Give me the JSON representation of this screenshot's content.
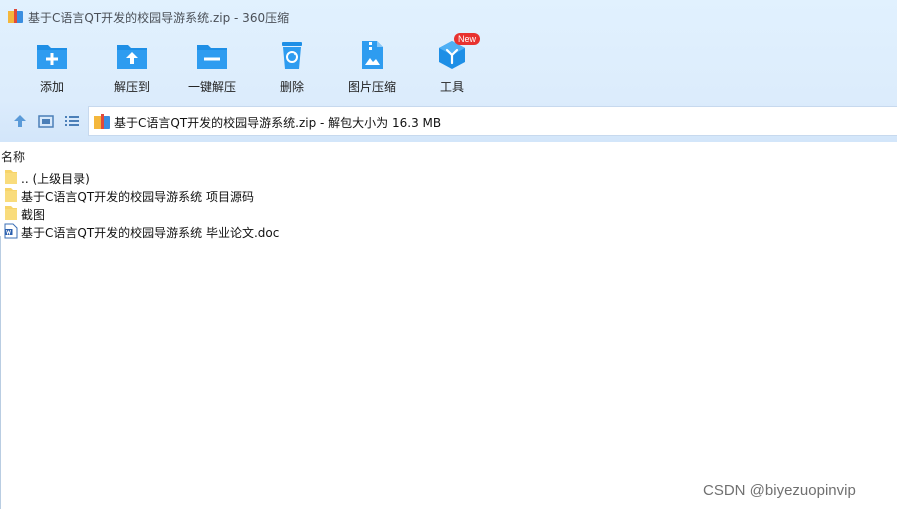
{
  "window": {
    "title": "基于C语言QT开发的校园导游系统.zip - 360压缩",
    "icon": "zip-archive-icon"
  },
  "toolbar": {
    "items": [
      {
        "label": "添加",
        "icon": "add-icon"
      },
      {
        "label": "解压到",
        "icon": "extract-to-icon"
      },
      {
        "label": "一键解压",
        "icon": "one-click-extract-icon"
      },
      {
        "label": "删除",
        "icon": "delete-icon"
      },
      {
        "label": "图片压缩",
        "icon": "image-compress-icon"
      },
      {
        "label": "工具",
        "icon": "tools-icon",
        "badge": "New"
      }
    ]
  },
  "nav": {
    "up_icon": "up-arrow-icon",
    "thumbnail_view_icon": "thumbnail-view-icon",
    "list_view_icon": "list-view-icon"
  },
  "address_bar": {
    "text": "基于C语言QT开发的校园导游系统.zip - 解包大小为 16.3 MB"
  },
  "columns": {
    "name": "名称"
  },
  "files": [
    {
      "name": ".. (上级目录)",
      "type": "folder"
    },
    {
      "name": "基于C语言QT开发的校园导游系统 项目源码",
      "type": "folder"
    },
    {
      "name": "截图",
      "type": "folder"
    },
    {
      "name": "基于C语言QT开发的校园导游系统 毕业论文.doc",
      "type": "doc"
    }
  ],
  "watermark": "CSDN @biyezuopinvip",
  "colors": {
    "toolbar_bg": "#dcecfc",
    "icon_blue": "#1e8fe6",
    "badge_red": "#e8322f",
    "folder_yellow": "#f7d46a"
  }
}
